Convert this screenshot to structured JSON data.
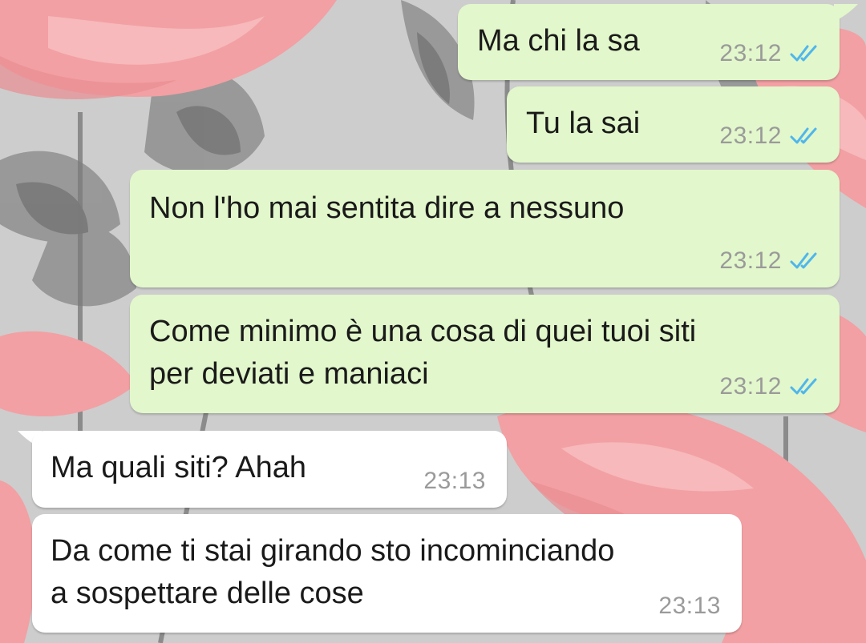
{
  "chat": {
    "messages": [
      {
        "direction": "outgoing",
        "text_lines": [
          "Ma chi la sa"
        ],
        "time": "23:12",
        "status": "read"
      },
      {
        "direction": "outgoing",
        "text_lines": [
          "Tu la sai"
        ],
        "time": "23:12",
        "status": "read"
      },
      {
        "direction": "outgoing",
        "text_lines": [
          "Non l'ho mai sentita dire a nessuno"
        ],
        "time": "23:12",
        "status": "read"
      },
      {
        "direction": "outgoing",
        "text_lines": [
          "Come minimo è una cosa di quei tuoi siti",
          "per deviati e maniaci"
        ],
        "time": "23:12",
        "status": "read"
      },
      {
        "direction": "incoming",
        "text_lines": [
          "Ma quali siti? Ahah"
        ],
        "time": "23:13"
      },
      {
        "direction": "incoming",
        "text_lines": [
          "Da come ti stai girando sto incominciando",
          "a sospettare delle cose"
        ],
        "time": "23:13"
      }
    ]
  },
  "theme": {
    "outgoing_bubble": "#e2f7cb",
    "incoming_bubble": "#ffffff",
    "read_tick": "#4fb6ec",
    "time_text": "#9a9a9a",
    "wallpaper_base": "#cfcfcf",
    "flamingo_pink": "#f3a3a6",
    "leaf_gray": "#8e8e8e"
  },
  "icons": {
    "read_status": "double-check-icon"
  }
}
